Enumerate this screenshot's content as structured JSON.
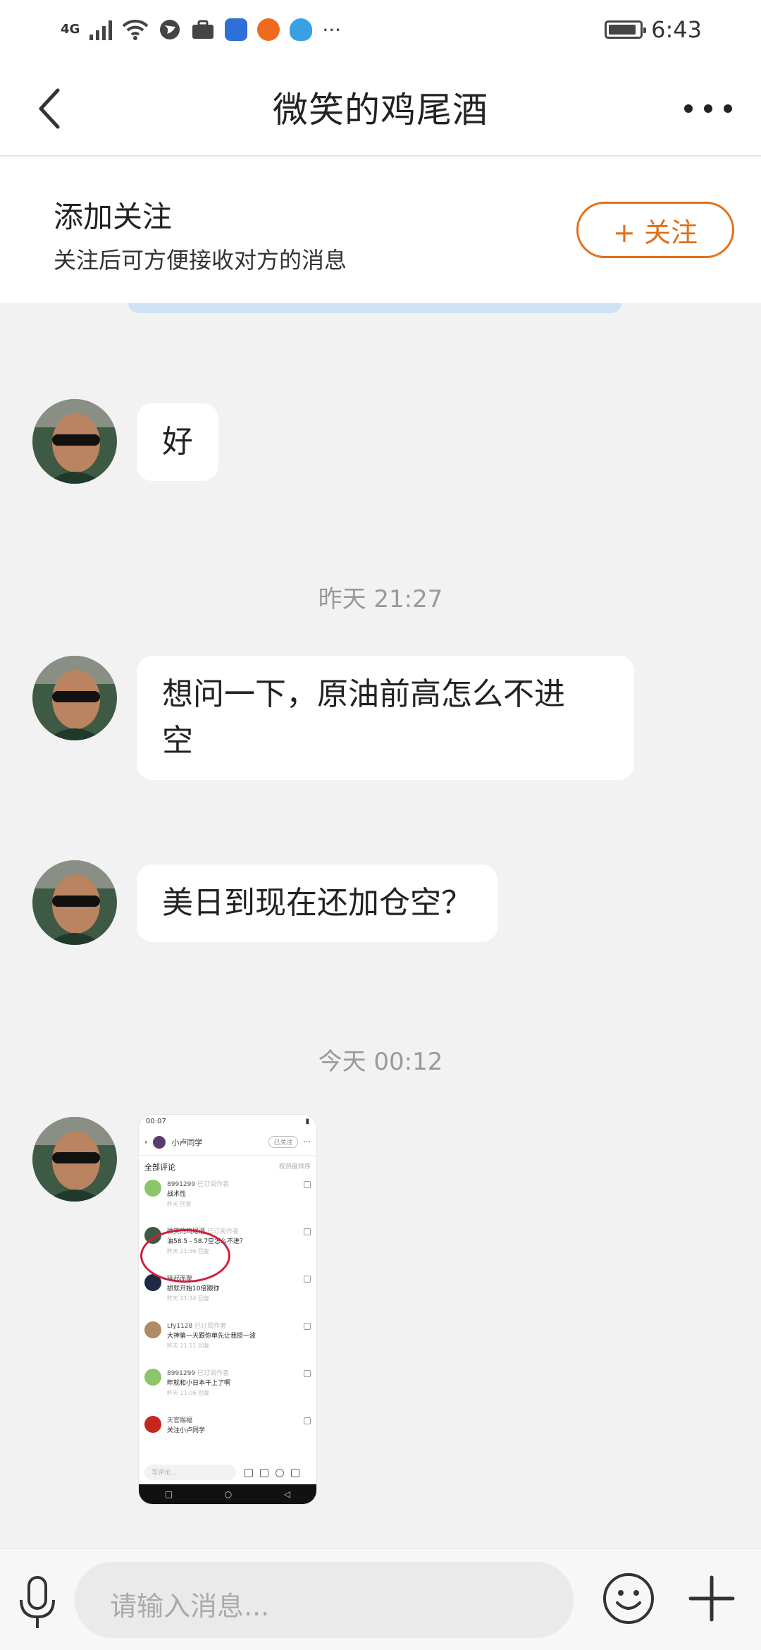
{
  "status_bar": {
    "network": "4G",
    "time": "6:43",
    "more": "···"
  },
  "header": {
    "title": "微笑的鸡尾酒"
  },
  "follow_banner": {
    "title": "添加关注",
    "subtitle": "关注后可方便接收对方的消息",
    "button_label": "+ 关注"
  },
  "messages": [
    {
      "text": "好"
    },
    {
      "time": "昨天 21:27"
    },
    {
      "text_line1": "想问一下，原油前高怎么不进",
      "text_line2": "空"
    },
    {
      "text": "美日到现在还加仓空？"
    },
    {
      "time": "今天 00:12"
    }
  ],
  "screenshot": {
    "status_time": "00:07",
    "account": "小卢同学",
    "followed": "已关注",
    "section": "全部评论",
    "sort": "按热度排序",
    "comments": [
      {
        "name": "8991299",
        "badge": "已订阅作者",
        "text": "战术性",
        "meta": "昨天 回复"
      },
      {
        "name": "微笑的鸡尾酒",
        "badge": "已订阅作者",
        "text": "油58.5 - 58.7空怎么不进？",
        "meta": "昨天 21:36 回复"
      },
      {
        "name": "锋起而聚",
        "badge": "",
        "text": "损就开始10倍跟你",
        "meta": "昨天 21:34 回复"
      },
      {
        "name": "Lfy1128",
        "badge": "已订阅作者",
        "text": "大神第一天跟你单先让我损一波",
        "meta": "昨天 21:11 回复"
      },
      {
        "name": "8991299",
        "badge": "已订阅作者",
        "text": "昨就和小日本干上了啊",
        "meta": "昨天 21:06 回复"
      },
      {
        "name": "天官赐福",
        "badge": "",
        "text": "关注小卢同学",
        "meta": ""
      }
    ],
    "input_placeholder": "写评论..."
  },
  "input_bar": {
    "placeholder": "请输入消息..."
  },
  "colors": {
    "accent": "#e2701a",
    "bubble": "#ffffff",
    "background": "#f2f2f2",
    "timestamp": "#9a9a9a"
  }
}
